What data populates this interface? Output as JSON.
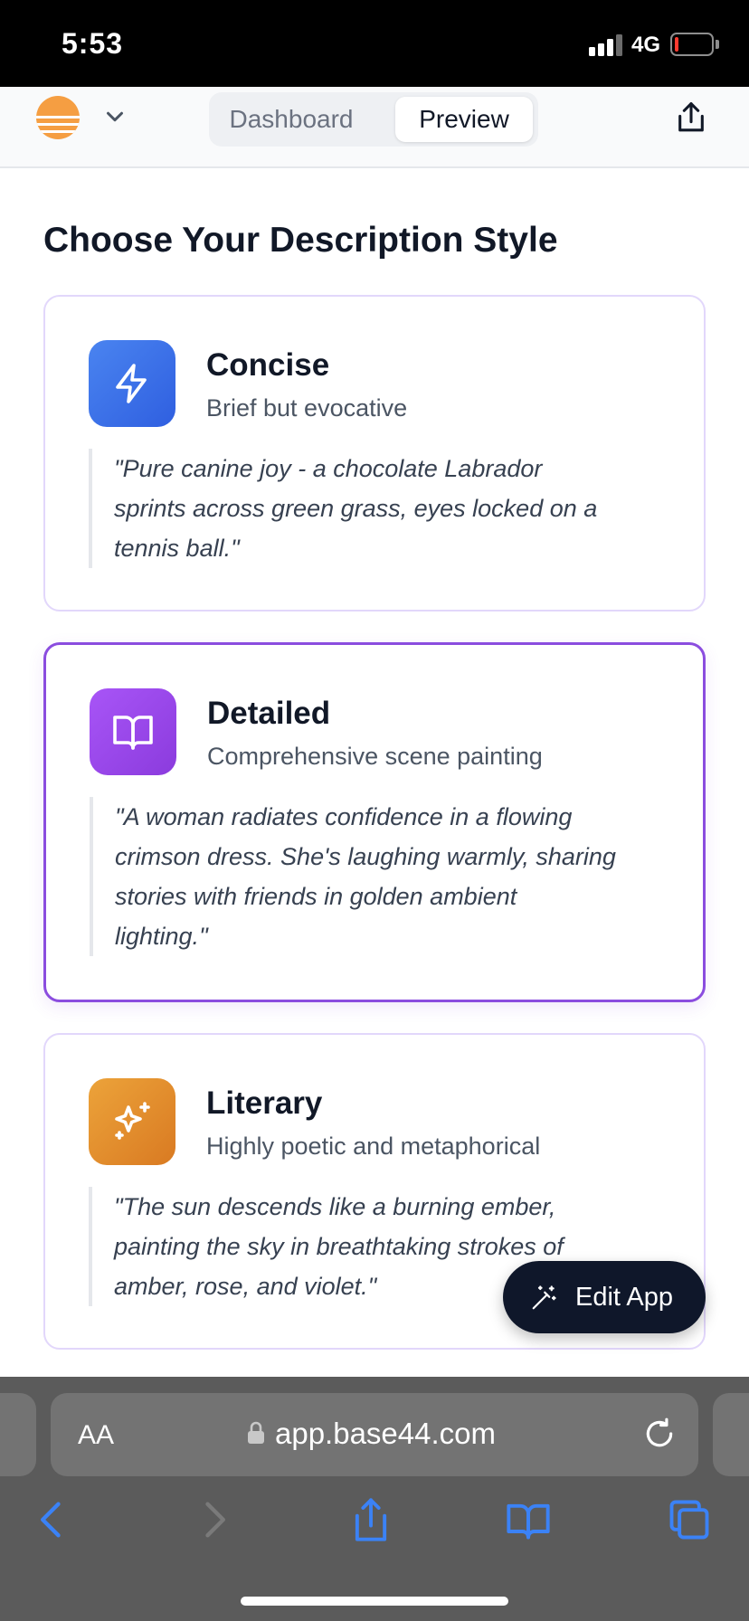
{
  "status_bar": {
    "time": "5:53",
    "network": "4G",
    "battery_level": 0.1
  },
  "header": {
    "tabs": [
      {
        "label": "Dashboard",
        "active": false
      },
      {
        "label": "Preview",
        "active": true
      }
    ],
    "icons": [
      "logo-icon",
      "chevron-down-icon",
      "share-icon"
    ]
  },
  "page_title": "Choose Your Description Style",
  "styles": [
    {
      "title": "Concise",
      "subtitle": "Brief but evocative",
      "quote_lines": [
        "\"Pure canine joy - a chocolate Labrador",
        "sprints across green grass, eyes locked on a",
        "tennis ball.\""
      ],
      "icon": "lightning-icon",
      "icon_color": "#3b6fe8",
      "selected": false
    },
    {
      "title": "Detailed",
      "subtitle": "Comprehensive scene painting",
      "quote_lines": [
        "\"A woman radiates confidence in a flowing",
        "crimson dress. She's laughing warmly, sharing",
        "stories with friends in golden ambient",
        "lighting.\""
      ],
      "icon": "book-open-icon",
      "icon_color": "#9a46e0",
      "selected": true
    },
    {
      "title": "Literary",
      "subtitle": "Highly poetic and metaphorical",
      "quote_lines": [
        "\"The sun descends like a burning ember,",
        "painting the sky in breathtaking strokes of",
        "amber, rose, and violet.\""
      ],
      "icon": "sparkles-icon",
      "icon_color": "#e38f2c",
      "selected": false
    }
  ],
  "fab": {
    "label": "Edit App",
    "icon": "magic-wand-icon"
  },
  "browser": {
    "text_size_label": "AA",
    "url": "app.base44.com",
    "icons": [
      "back-icon",
      "forward-icon",
      "share-icon",
      "bookmarks-icon",
      "tabs-icon",
      "lock-icon",
      "reload-icon"
    ]
  },
  "colors": {
    "accent": "#8b4ddf",
    "card_border": "#e2d7fb",
    "fab_bg": "#0f172a"
  }
}
